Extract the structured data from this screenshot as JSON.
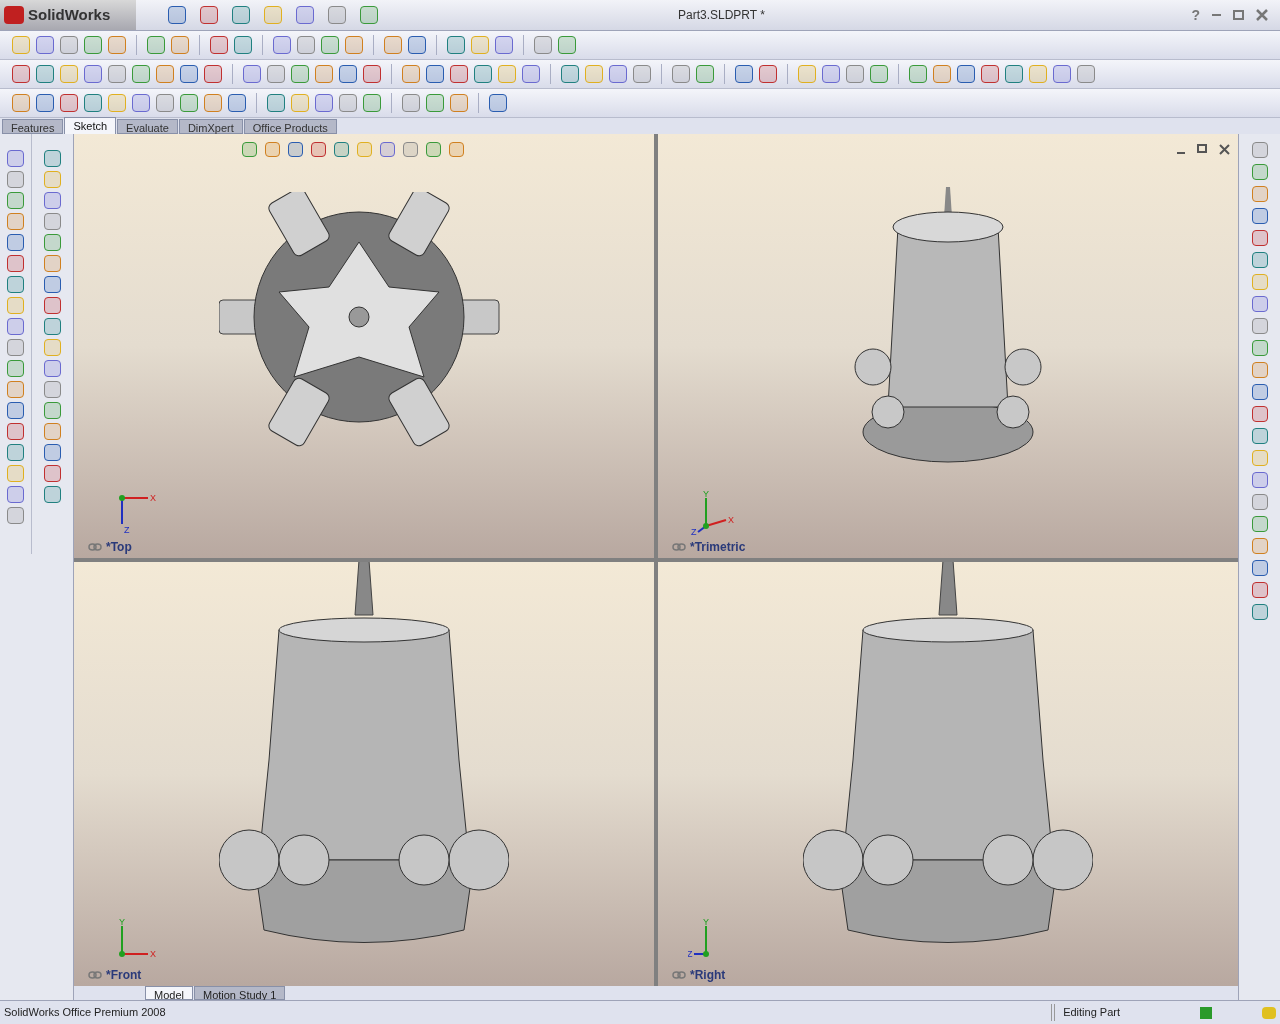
{
  "app": {
    "name": "SolidWorks"
  },
  "window": {
    "title": "Part3.SLDPRT *"
  },
  "command_tabs": [
    {
      "label": "Features",
      "selected": false
    },
    {
      "label": "Sketch",
      "selected": true
    },
    {
      "label": "Evaluate",
      "selected": false
    },
    {
      "label": "DimXpert",
      "selected": false
    },
    {
      "label": "Office Products",
      "selected": false
    }
  ],
  "viewports": [
    {
      "label": "*Top",
      "kind": "top",
      "axes": [
        {
          "kind": "x",
          "label": "X"
        },
        {
          "kind": "z",
          "label": "Z"
        }
      ]
    },
    {
      "label": "*Trimetric",
      "kind": "iso",
      "axes": [
        {
          "kind": "x",
          "label": "X"
        },
        {
          "kind": "y",
          "label": "Y"
        },
        {
          "kind": "z",
          "label": "Z"
        }
      ]
    },
    {
      "label": "*Front",
      "kind": "side",
      "axes": [
        {
          "kind": "x",
          "label": "X"
        },
        {
          "kind": "y",
          "label": "Y"
        }
      ]
    },
    {
      "label": "*Right",
      "kind": "side",
      "axes": [
        {
          "kind": "z",
          "label": "Z"
        },
        {
          "kind": "y",
          "label": "Y"
        }
      ]
    }
  ],
  "help": "?",
  "bottom_tabs": [
    {
      "label": "Model",
      "selected": true
    },
    {
      "label": "Motion Study 1",
      "selected": false
    }
  ],
  "status_bar": {
    "product": "SolidWorks Office Premium 2008",
    "mode": "Editing Part"
  }
}
